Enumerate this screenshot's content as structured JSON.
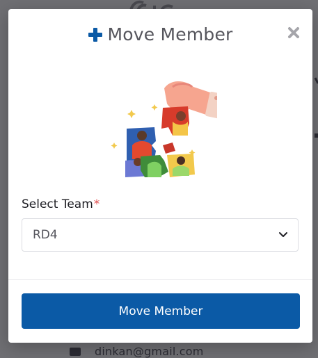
{
  "modal": {
    "title": "Move Member",
    "plus_icon": "plus-icon",
    "close_icon": "close-icon",
    "form": {
      "label": "Select Team",
      "required_mark": "*",
      "selected_value": "RD4",
      "chevron_icon": "chevron-down-icon"
    },
    "submit_label": "Move Member"
  },
  "background": {
    "email_icon": "envelope-icon",
    "email": "dinkan@gmail.com"
  },
  "colors": {
    "accent": "#0b5aa6",
    "required": "#e04e4e",
    "overlay": "#6f6f73"
  }
}
